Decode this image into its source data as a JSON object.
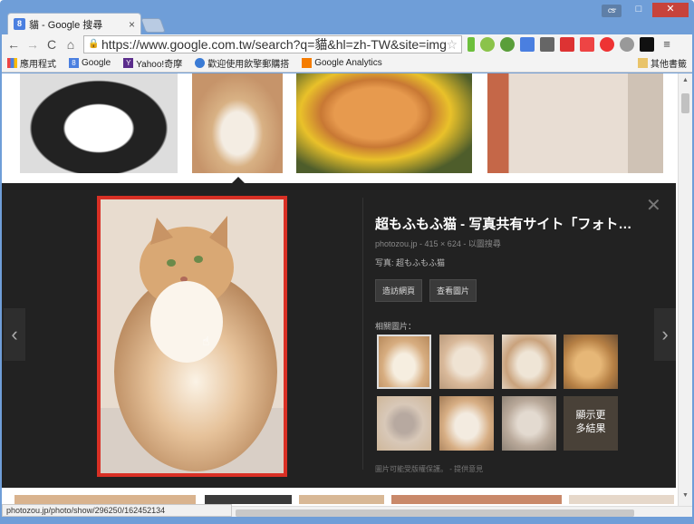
{
  "window": {
    "tab_title": "貓 - Google 搜尋",
    "tab_favicon": "8",
    "user_badge": "cs",
    "minimize": "–",
    "maximize": "□",
    "close": "✕"
  },
  "toolbar": {
    "url": "https://www.google.com.tw/search?q=貓&hl=zh-TW&site=imghp&"
  },
  "bookmarks": {
    "items": [
      "應用程式",
      "Google",
      "Yahoo!奇摩",
      "歡迎使用飲擎郵購搭",
      "Google Analytics"
    ],
    "other": "其他書籤"
  },
  "lightbox": {
    "title": "超もふもふ猫 - 写真共有サイト「フォト…",
    "meta": "photozou.jp - 415 × 624 - 以圖搜尋",
    "caption": "写真: 超もふもふ猫",
    "visit_button": "造訪網頁",
    "view_button": "查看圖片",
    "related_label": "相關圖片：",
    "more_results_line1": "顯示更",
    "more_results_line2": "多結果",
    "footer": "圖片可能受版權保護。 - 提供意見"
  },
  "status": {
    "url": "photozou.jp/photo/show/296250/162452134"
  },
  "colors": {
    "frame": "#6f9ed8",
    "lightbox_bg": "#222222",
    "preview_border": "#d93025"
  }
}
